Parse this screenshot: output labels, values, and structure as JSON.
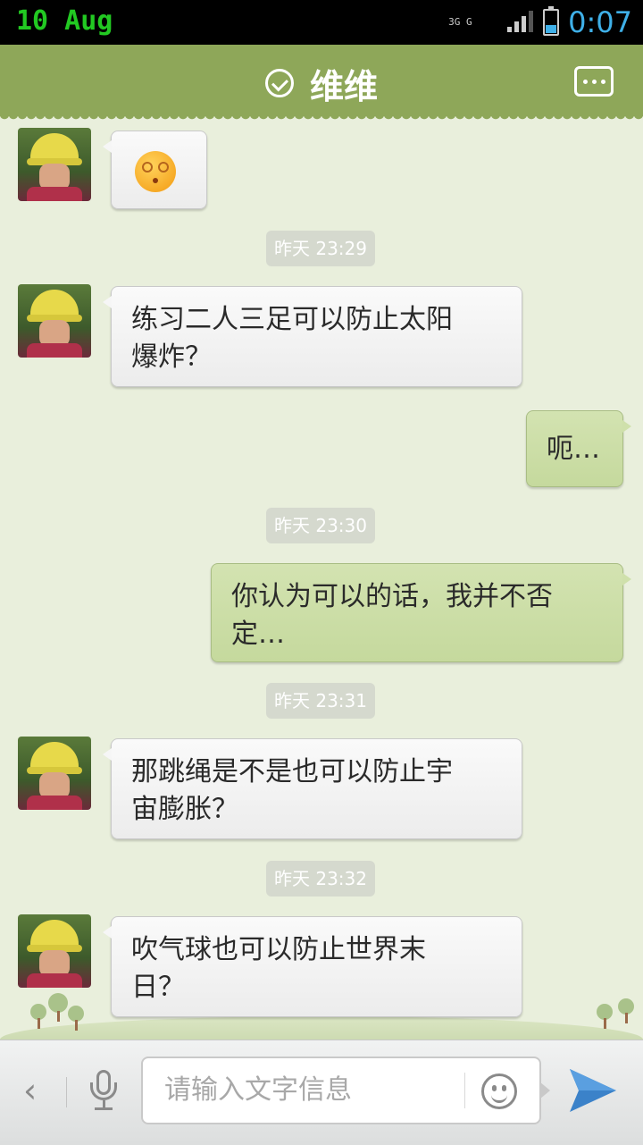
{
  "status_bar": {
    "date": "10 Aug",
    "network": "3G",
    "carrier": "G",
    "time": "0:07"
  },
  "header": {
    "title": "维维"
  },
  "conversation": {
    "msg1": {
      "type": "emoji",
      "emoji": "dizzy-face"
    },
    "time1": "昨天 23:29",
    "msg2": {
      "line1": "练习二人三足可以防止太阳",
      "line2": "爆炸？"
    },
    "msg3": {
      "line1": "呃…"
    },
    "time2": "昨天 23:30",
    "msg4": {
      "line1": "你认为可以的话，我并不否",
      "line2": "定…"
    },
    "time3": "昨天 23:31",
    "msg5": {
      "line1": "那跳绳是不是也可以防止宇",
      "line2": "宙膨胀？"
    },
    "time4": "昨天 23:32",
    "msg6": {
      "line1": "吹气球也可以防止世界末",
      "line2": "日？"
    }
  },
  "input_bar": {
    "placeholder": "请输入文字信息"
  },
  "colors": {
    "header": "#8ea759",
    "background": "#e9efdc",
    "outgoing_bubble": "#cfe0ab",
    "send": "#3b82c9"
  }
}
